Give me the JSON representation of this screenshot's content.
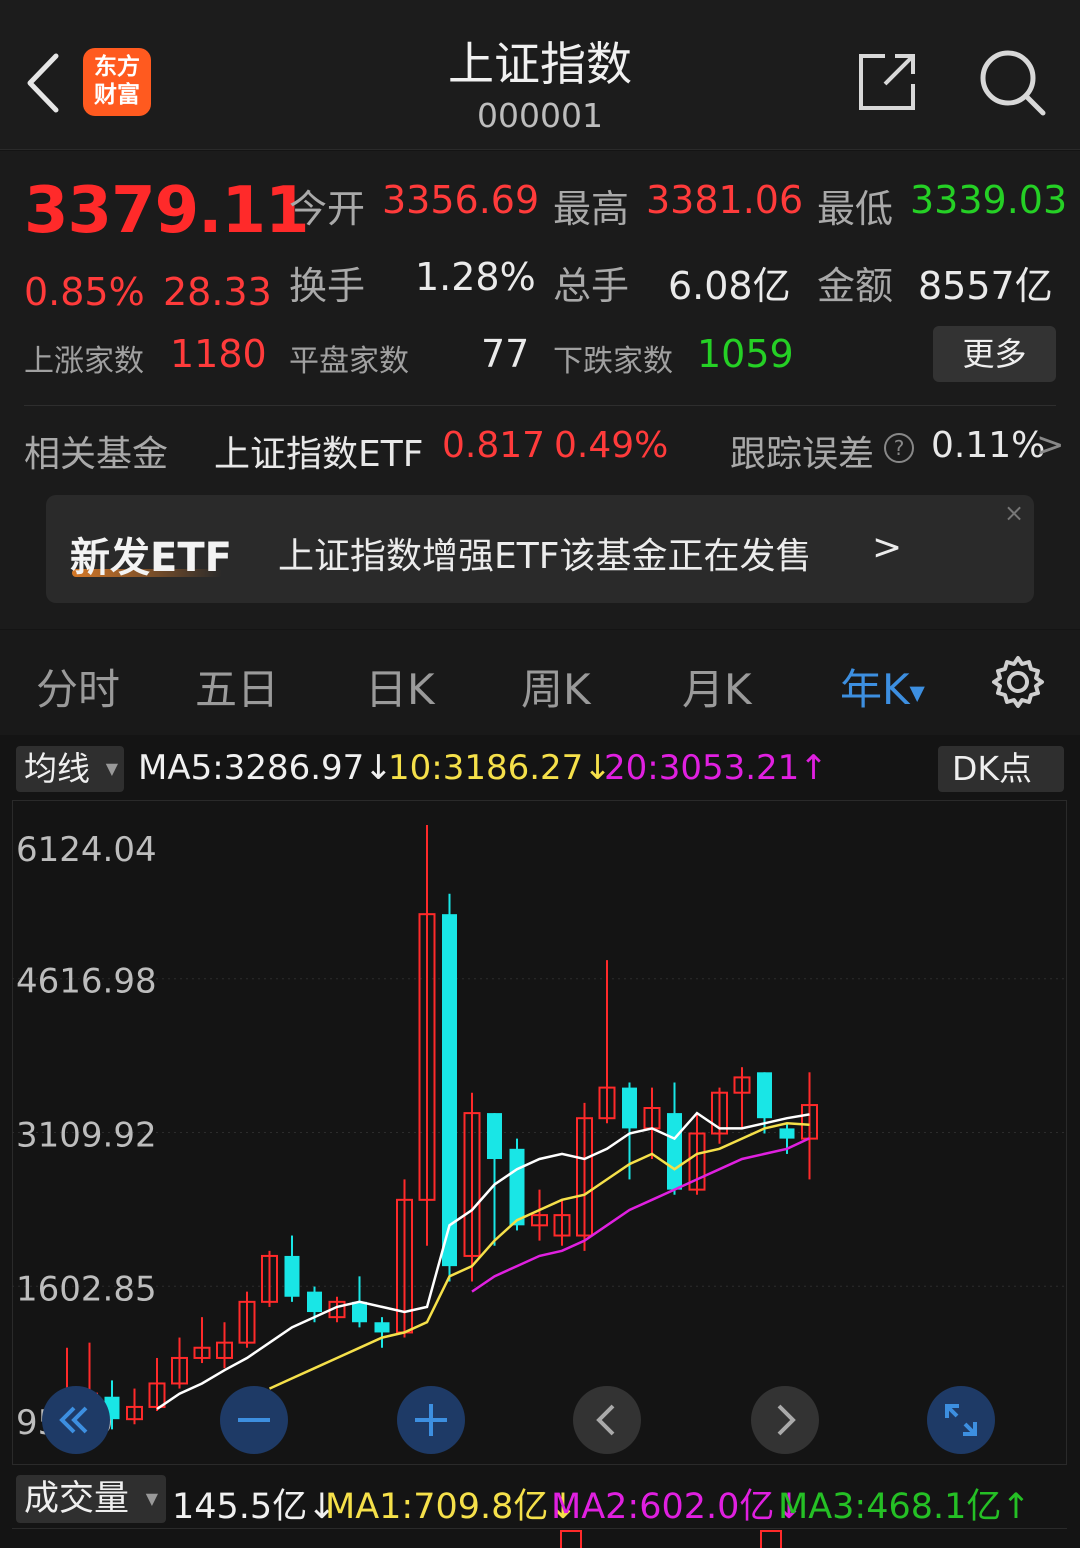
{
  "header": {
    "title": "上证指数",
    "code": "000001",
    "logo_text": "东方\n财富"
  },
  "quote": {
    "price": "3379.11",
    "change_pct": "0.85%",
    "change_abs": "28.33",
    "open_label": "今开",
    "open_value": "3356.69",
    "high_label": "最高",
    "high_value": "3381.06",
    "low_label": "最低",
    "low_value": "3339.03",
    "turnover_label": "换手",
    "turnover_value": "1.28%",
    "volume_label": "总手",
    "volume_value": "6.08亿",
    "amount_label": "金额",
    "amount_value": "8557亿",
    "up_label": "上涨家数",
    "up_value": "1180",
    "flat_label": "平盘家数",
    "flat_value": "77",
    "down_label": "下跌家数",
    "down_value": "1059",
    "more_label": "更多"
  },
  "fund": {
    "label": "相关基金",
    "name": "上证指数ETF",
    "price": "0.817",
    "pct": "0.49%",
    "tracking_label": "跟踪误差",
    "tracking_value": "0.11%",
    "arrow": ">"
  },
  "banner": {
    "tag": "新发ETF",
    "text": "上证指数增强ETF该基金正在发售",
    "arrow": ">",
    "close": "×"
  },
  "tabs": [
    {
      "label": "分时"
    },
    {
      "label": "五日"
    },
    {
      "label": "日K"
    },
    {
      "label": "周K"
    },
    {
      "label": "月K"
    },
    {
      "label": "年K"
    }
  ],
  "ma": {
    "selector": "均线",
    "ma5": "MA5:3286.97↓",
    "ma10": "10:3186.27↓",
    "ma20": "20:3053.21↑",
    "dk": "DK点"
  },
  "volume": {
    "selector": "成交量",
    "value": "145.5亿↓",
    "ma1": "MA1:709.8亿↓",
    "ma2": "MA2:602.0亿↓",
    "ma3": "MA3:468.1亿↑"
  },
  "colors": {
    "up": "#ff2a2a",
    "down": "#19e6e6",
    "ma5": "#ffffff",
    "ma10": "#f5e04a",
    "ma20": "#e020e0",
    "accent": "#3d8fe0"
  },
  "chart_data": {
    "type": "candlestick",
    "ytick_labels": [
      "6124.04",
      "4616.98",
      "3109.92",
      "1602.85",
      "95.79"
    ],
    "ylim": [
      95.79,
      6124.04
    ],
    "candles": [
      {
        "o": 300,
        "c": 520,
        "h": 1000,
        "l": 100
      },
      {
        "o": 500,
        "c": 550,
        "h": 1050,
        "l": 330
      },
      {
        "o": 520,
        "c": 300,
        "h": 680,
        "l": 200
      },
      {
        "o": 300,
        "c": 420,
        "h": 600,
        "l": 250
      },
      {
        "o": 420,
        "c": 650,
        "h": 900,
        "l": 380
      },
      {
        "o": 650,
        "c": 900,
        "h": 1100,
        "l": 600
      },
      {
        "o": 900,
        "c": 1000,
        "h": 1300,
        "l": 850
      },
      {
        "o": 900,
        "c": 1050,
        "h": 1250,
        "l": 800
      },
      {
        "o": 1050,
        "c": 1450,
        "h": 1550,
        "l": 1000
      },
      {
        "o": 1450,
        "c": 1900,
        "h": 1950,
        "l": 1400
      },
      {
        "o": 1900,
        "c": 1500,
        "h": 2100,
        "l": 1450
      },
      {
        "o": 1550,
        "c": 1350,
        "h": 1600,
        "l": 1250
      },
      {
        "o": 1300,
        "c": 1450,
        "h": 1500,
        "l": 1250
      },
      {
        "o": 1450,
        "c": 1250,
        "h": 1700,
        "l": 1200
      },
      {
        "o": 1250,
        "c": 1150,
        "h": 1300,
        "l": 1000
      },
      {
        "o": 1150,
        "c": 2450,
        "h": 2650,
        "l": 1100
      },
      {
        "o": 2450,
        "c": 5250,
        "h": 6124,
        "l": 2000
      },
      {
        "o": 5250,
        "c": 1800,
        "h": 5450,
        "l": 1650
      },
      {
        "o": 1900,
        "c": 3300,
        "h": 3500,
        "l": 1650
      },
      {
        "o": 3300,
        "c": 2850,
        "h": 3300,
        "l": 2000
      },
      {
        "o": 2950,
        "c": 2200,
        "h": 3050,
        "l": 2150
      },
      {
        "o": 2200,
        "c": 2300,
        "h": 2550,
        "l": 2050
      },
      {
        "o": 2100,
        "c": 2300,
        "h": 2450,
        "l": 2000
      },
      {
        "o": 2100,
        "c": 3250,
        "h": 3400,
        "l": 1950
      },
      {
        "o": 3250,
        "c": 3550,
        "h": 4800,
        "l": 3200
      },
      {
        "o": 3550,
        "c": 3150,
        "h": 3600,
        "l": 2650
      },
      {
        "o": 3150,
        "c": 3350,
        "h": 3550,
        "l": 2850
      },
      {
        "o": 3300,
        "c": 2550,
        "h": 3600,
        "l": 2500
      },
      {
        "o": 2550,
        "c": 3100,
        "h": 3300,
        "l": 2500
      },
      {
        "o": 3100,
        "c": 3500,
        "h": 3550,
        "l": 3000
      },
      {
        "o": 3500,
        "c": 3650,
        "h": 3750,
        "l": 3150
      },
      {
        "o": 3700,
        "c": 3250,
        "h": 3700,
        "l": 3100
      },
      {
        "o": 3150,
        "c": 3050,
        "h": 3200,
        "l": 2900
      },
      {
        "o": 3050,
        "c": 3379,
        "h": 3700,
        "l": 2650
      }
    ],
    "ma5": [
      null,
      null,
      null,
      null,
      400,
      550,
      650,
      780,
      900,
      1050,
      1200,
      1300,
      1400,
      1450,
      1400,
      1350,
      1400,
      2200,
      2350,
      2600,
      2750,
      2850,
      2900,
      2850,
      2950,
      3100,
      3150,
      3050,
      3300,
      3150,
      3150,
      3200,
      3250,
      3287
    ],
    "ma10": [
      null,
      null,
      null,
      null,
      null,
      null,
      null,
      null,
      null,
      600,
      700,
      800,
      900,
      1000,
      1100,
      1150,
      1250,
      1700,
      1800,
      2050,
      2250,
      2350,
      2450,
      2500,
      2650,
      2800,
      2900,
      2750,
      2900,
      2950,
      3050,
      3150,
      3200,
      3186
    ],
    "ma20": [
      null,
      null,
      null,
      null,
      null,
      null,
      null,
      null,
      null,
      null,
      null,
      null,
      null,
      null,
      null,
      null,
      null,
      null,
      1550,
      1700,
      1800,
      1900,
      1950,
      2050,
      2200,
      2350,
      2450,
      2550,
      2650,
      2750,
      2850,
      2900,
      2950,
      3053
    ]
  }
}
